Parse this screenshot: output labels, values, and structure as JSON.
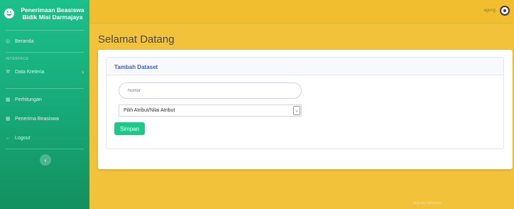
{
  "sidebar": {
    "brand": "Penerimaan Beasiswa Bidik Misi Darmajaya",
    "items": [
      {
        "label": "Beranda",
        "icon": "dashboard-icon"
      },
      {
        "label": "Data Kreteria",
        "icon": "wrench-icon"
      },
      {
        "label": "Perhitungan",
        "icon": "table-icon"
      },
      {
        "label": "Penerima Beasiswa",
        "icon": "table-icon"
      },
      {
        "label": "Logout",
        "icon": "arrow-left-icon"
      }
    ],
    "heading": "INTERFACE",
    "toggle_icon": "chevron-left-icon"
  },
  "topbar": {
    "user_name": "agung",
    "avatar_icon": "user-avatar-icon"
  },
  "main": {
    "title": "Selamat Datang",
    "card_title": "Tambah Dataset",
    "nomor_placeholder": "Nomor",
    "select_value": "Pilih Atribut/Nilai Atribut",
    "submit_label": "Simpan"
  },
  "footer": {
    "text": "Activate Windows"
  },
  "colors": {
    "sidebar": "#17a878",
    "background": "#f2c23a",
    "primary": "#3a5fcd",
    "success": "#1cc88a"
  }
}
